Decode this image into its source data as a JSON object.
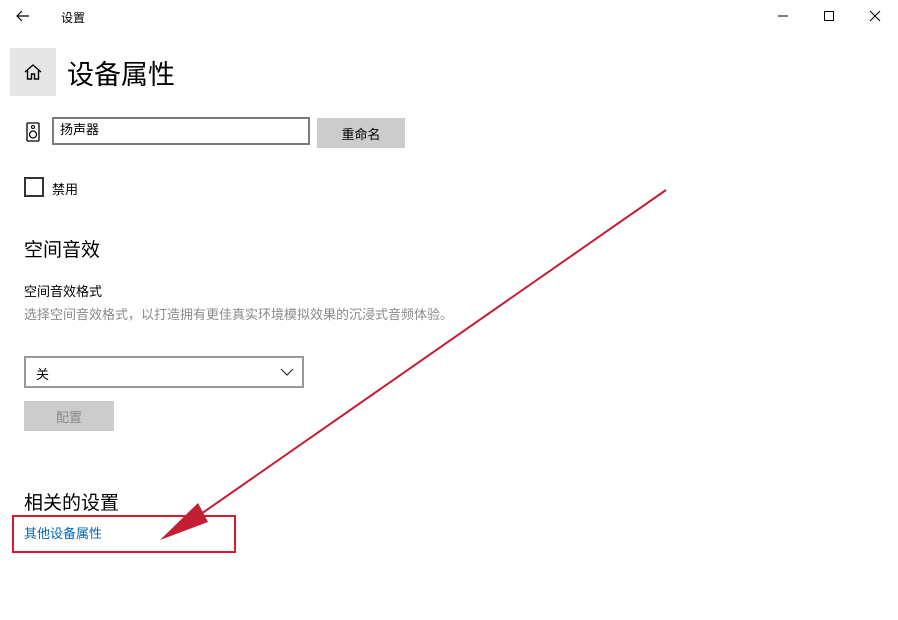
{
  "window": {
    "title": "设置",
    "back_icon": "arrow-left-icon",
    "minimize_icon": "minimize-icon",
    "maximize_icon": "maximize-icon",
    "close_icon": "close-icon"
  },
  "header": {
    "home_icon": "home-icon",
    "page_title": "设备属性"
  },
  "device": {
    "icon": "speaker-icon",
    "name_value": "扬声器",
    "rename_label": "重命名",
    "disable_label": "禁用",
    "disable_checked": false
  },
  "spatial": {
    "section_title": "空间音效",
    "format_label": "空间音效格式",
    "description": "选择空间音效格式，以打造拥有更佳真实环境模拟效果的沉浸式音频体验。",
    "selected_format": "关",
    "configure_label": "配置",
    "configure_enabled": false
  },
  "related": {
    "section_title": "相关的设置",
    "link_label": "其他设备属性"
  },
  "annotation": {
    "color": "#d9182d",
    "type": "arrow-and-highlight-box"
  }
}
